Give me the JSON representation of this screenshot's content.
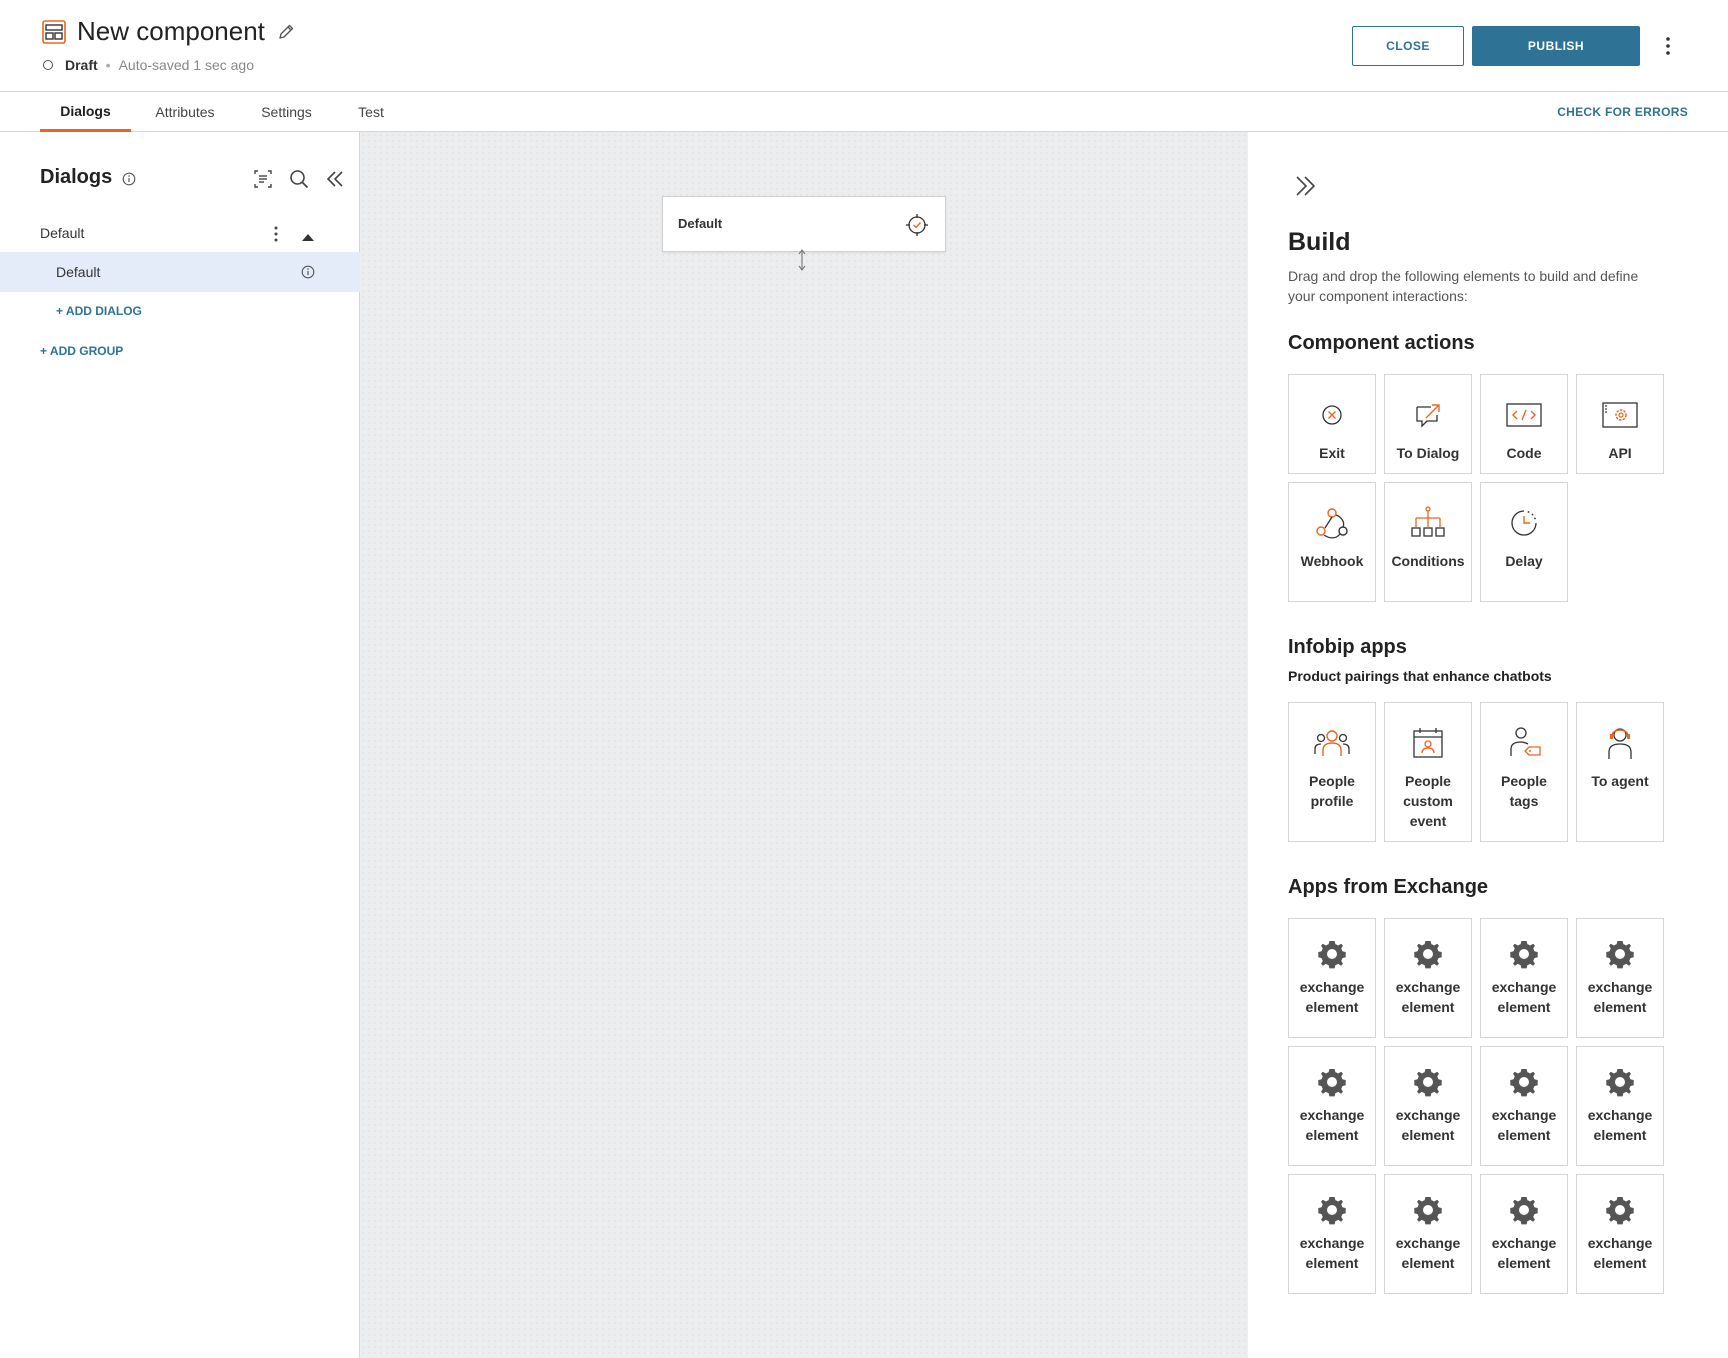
{
  "header": {
    "title": "New component",
    "status": "Draft",
    "separator": "•",
    "autosave": "Auto-saved 1 sec ago",
    "close_label": "CLOSE",
    "publish_label": "PUBLISH"
  },
  "tabs": [
    {
      "label": "Dialogs",
      "active": true
    },
    {
      "label": "Attributes",
      "active": false
    },
    {
      "label": "Settings",
      "active": false
    },
    {
      "label": "Test",
      "active": false
    }
  ],
  "check_errors_label": "CHECK FOR ERRORS",
  "sidebar": {
    "title": "Dialogs",
    "group": "Default",
    "dialog": "Default",
    "add_dialog": "+ ADD DIALOG",
    "add_group": "+ ADD GROUP"
  },
  "canvas": {
    "node_label": "Default"
  },
  "panel": {
    "title": "Build",
    "description": "Drag and drop the following elements to build and define your component interactions:",
    "component_actions": {
      "title": "Component actions",
      "items": [
        "Exit",
        "To Dialog",
        "Code",
        "API",
        "Webhook",
        "Conditions",
        "Delay"
      ]
    },
    "infobip_apps": {
      "title": "Infobip apps",
      "subtitle": "Product pairings that enhance chatbots",
      "items": [
        "People profile",
        "People custom event",
        "People tags",
        "To agent"
      ]
    },
    "exchange": {
      "title": "Apps from Exchange",
      "items": [
        "exchange element",
        "exchange element",
        "exchange element",
        "exchange element",
        "exchange element",
        "exchange element",
        "exchange element",
        "exchange element",
        "exchange element",
        "exchange element",
        "exchange element",
        "exchange element"
      ]
    }
  },
  "colors": {
    "accent": "#f0631e",
    "primary": "#2e7395",
    "selected_row": "#e4ecf9",
    "canvas": "#ecedef"
  }
}
